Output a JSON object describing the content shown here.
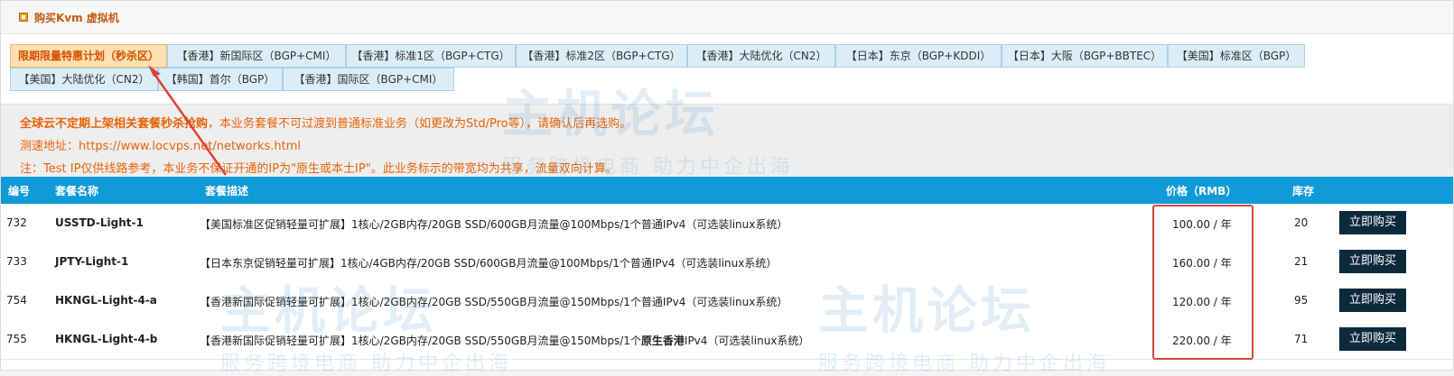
{
  "header": {
    "title": "购买Kvm 虚拟机"
  },
  "tabs": [
    {
      "label": "限期限量特惠计划（秒杀区）",
      "active": true
    },
    {
      "label": "【香港】新国际区（BGP+CMI）"
    },
    {
      "label": "【香港】标准1区（BGP+CTG）"
    },
    {
      "label": "【香港】标准2区（BGP+CTG）"
    },
    {
      "label": "【香港】大陆优化（CN2）"
    },
    {
      "label": "【日本】东京（BGP+KDDI）"
    },
    {
      "label": "【日本】大阪（BGP+BBTEC）"
    },
    {
      "label": "【美国】标准区（BGP）"
    },
    {
      "label": "【美国】大陆优化（CN2）"
    },
    {
      "label": "【韩国】首尔（BGP）"
    },
    {
      "label": "【香港】国际区（BGP+CMI）"
    }
  ],
  "notice": {
    "bold_text": "全球云不定期上架相关套餐秒杀抢购",
    "rest_text": "，本业务套餐不可过渡到普通标准业务（如更改为Std/Pro等），请确认后再选购。",
    "speedtest": "测速地址：https://www.locvps.net/networks.html",
    "note": "注：Test IP仅供线路参考，本业务不保证开通的IP为\"原生或本土IP\"。此业务标示的带宽均为共享，流量双向计算。"
  },
  "table": {
    "headers": {
      "id": "编号",
      "name": "套餐名称",
      "desc": "套餐描述",
      "price": "价格（RMB）",
      "stock": "库存"
    },
    "buy_label": "立即购买",
    "rows": [
      {
        "id": "732",
        "name": "USSTD-Light-1",
        "desc": "【美国标准区促销轻量可扩展】1核心/2GB内存/20GB SSD/600GB月流量@100Mbps/1个普通IPv4（可选装linux系统）",
        "price": "100.00 / 年",
        "stock": "20"
      },
      {
        "id": "733",
        "name": "JPTY-Light-1",
        "desc": "【日本东京促销轻量可扩展】1核心/4GB内存/20GB SSD/600GB月流量@100Mbps/1个普通IPv4（可选装linux系统）",
        "price": "160.00 / 年",
        "stock": "21"
      },
      {
        "id": "754",
        "name": "HKNGL-Light-4-a",
        "desc": "【香港新国际促销轻量可扩展】1核心/2GB内存/20GB SSD/550GB月流量@150Mbps/1个普通IPv4（可选装linux系统）",
        "price": "120.00 / 年",
        "stock": "95"
      },
      {
        "id": "755",
        "name": "HKNGL-Light-4-b",
        "desc_main": "【香港新国际促销轻量可扩展】1核心/2GB内存/20GB SSD/550GB月流量@150Mbps/1个",
        "desc_bold": "原生香港",
        "desc_tail": "IPv4（可选装linux系统）",
        "price": "220.00 / 年",
        "stock": "71"
      }
    ]
  },
  "watermark": {
    "title": "主机论坛",
    "slogan": "服务跨境电商 助力中企出海"
  },
  "colors": {
    "accent": "#109ad8",
    "notice": "#e8630a",
    "highlight_box": "#d24a3c",
    "buy_button": "#0d2a3d"
  }
}
